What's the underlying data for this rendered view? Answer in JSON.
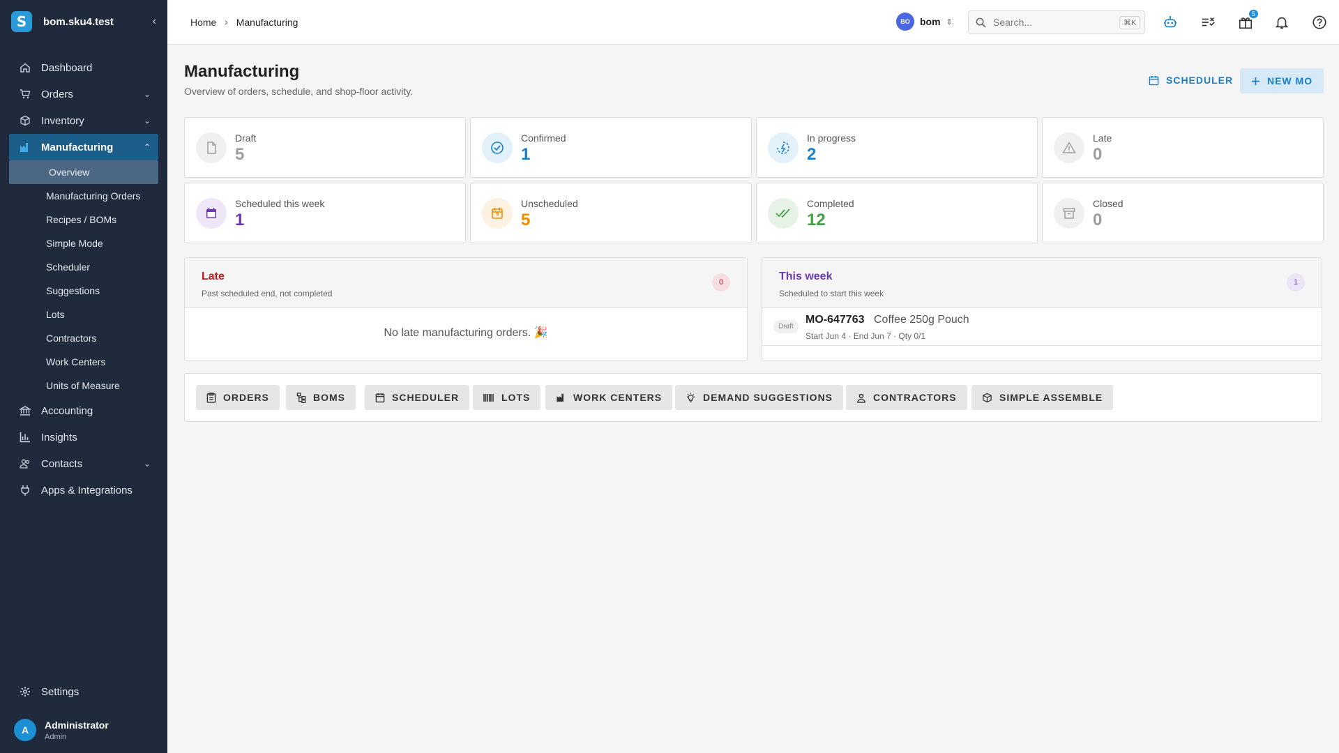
{
  "sidebar": {
    "org": "bom.sku4.test",
    "logo_letter": "S",
    "collapse_icon": "chevron-left-icon",
    "items": [
      {
        "label": "Dashboard",
        "icon": "home-icon"
      },
      {
        "label": "Orders",
        "icon": "cart-icon"
      },
      {
        "label": "Inventory",
        "icon": "box-icon"
      },
      {
        "label": "Manufacturing",
        "icon": "factory-icon"
      },
      {
        "label": "Accounting",
        "icon": "bank-icon"
      },
      {
        "label": "Insights",
        "icon": "bar-chart-icon"
      },
      {
        "label": "Contacts",
        "icon": "people-icon"
      },
      {
        "label": "Apps & Integrations",
        "icon": "plug-icon"
      }
    ],
    "sub_items": [
      "Overview",
      "Manufacturing Orders",
      "Recipes / BOMs",
      "Simple Mode",
      "Scheduler",
      "Suggestions",
      "Lots",
      "Contractors",
      "Work Centers",
      "Units of Measure"
    ],
    "settings": "Settings",
    "user": {
      "initial": "A",
      "name": "Administrator",
      "role": "Admin"
    }
  },
  "topbar": {
    "breadcrumb": {
      "home": "Home",
      "separator": "›",
      "current": "Manufacturing"
    },
    "workspace": {
      "badge": "BO",
      "name": "bom"
    },
    "search": {
      "placeholder": "Search...",
      "shortcut": "⌘K"
    },
    "gift_badge": "5"
  },
  "page": {
    "title": "Manufacturing",
    "subtitle": "Overview of orders, schedule, and shop-floor activity.",
    "scheduler_button": "SCHEDULER",
    "new_button": "NEW MO"
  },
  "stats": [
    {
      "label": "Draft",
      "value": "5",
      "color": "#9e9e9e"
    },
    {
      "label": "Confirmed",
      "value": "1",
      "color": "#1b7fc4"
    },
    {
      "label": "In progress",
      "value": "2",
      "color": "#1b7fc4"
    },
    {
      "label": "Late",
      "value": "0",
      "color": "#9e9e9e"
    },
    {
      "label": "Scheduled this week",
      "value": "1",
      "color": "#6a3ab0"
    },
    {
      "label": "Unscheduled",
      "value": "5",
      "color": "#f08c00"
    },
    {
      "label": "Completed",
      "value": "12",
      "color": "#43a047"
    },
    {
      "label": "Closed",
      "value": "0",
      "color": "#9e9e9e"
    }
  ],
  "late_panel": {
    "title": "Late",
    "subtitle": "Past scheduled end, not completed",
    "count": "0",
    "empty": "No late manufacturing orders. 🎉"
  },
  "week_panel": {
    "title": "This week",
    "subtitle": "Scheduled to start this week",
    "count": "1",
    "orders": [
      {
        "status": "Draft",
        "id": "MO-647763",
        "product": "Coffee 250g Pouch",
        "meta": "Start Jun 4  · End Jun 7  · Qty 0/1"
      }
    ]
  },
  "quick_links": [
    "ORDERS",
    "BOMS",
    "SCHEDULER",
    "LOTS",
    "WORK CENTERS",
    "DEMAND SUGGESTIONS",
    "CONTRACTORS",
    "SIMPLE ASSEMBLE"
  ]
}
